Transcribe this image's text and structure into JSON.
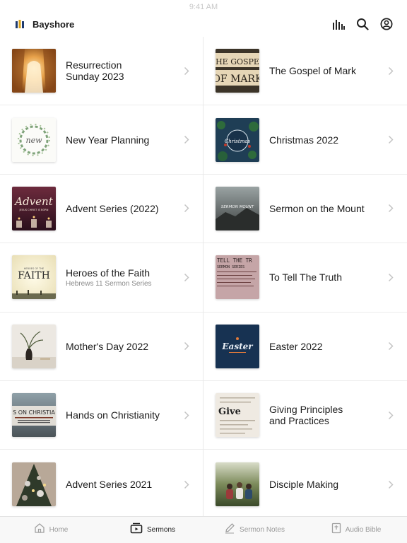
{
  "status": {
    "time": "9:41 AM"
  },
  "header": {
    "app_title": "Bayshore",
    "icons": [
      "logo-icon",
      "audio-bars-icon",
      "search-icon",
      "account-icon"
    ]
  },
  "sermons": {
    "left": [
      {
        "title": "Resurrection\nSunday 2023",
        "subtitle": "",
        "thumb": "tomb"
      },
      {
        "title": "New Year Planning",
        "subtitle": "",
        "thumb": "newyear",
        "thumb_text": "new"
      },
      {
        "title": "Advent Series (2022)",
        "subtitle": "",
        "thumb": "advent",
        "thumb_text": "Advent",
        "thumb_sub": "JESUS CHRIST IS BORN"
      },
      {
        "title": "Heroes of the Faith",
        "subtitle": "Hebrews 11 Sermon Series",
        "thumb": "faith",
        "thumb_text": "FAITH",
        "thumb_sub": "HEROES OF THE"
      },
      {
        "title": "Mother's Day 2022",
        "subtitle": "",
        "thumb": "vase"
      },
      {
        "title": "Hands on Christianity",
        "subtitle": "",
        "thumb": "hands",
        "thumb_text": "S ON CHRISTIA"
      },
      {
        "title": "Advent Series 2021",
        "subtitle": "",
        "thumb": "tree"
      }
    ],
    "right": [
      {
        "title": "The Gospel of Mark",
        "subtitle": "",
        "thumb": "mark",
        "thumb_text": "THE GOSPEL",
        "thumb_sub": "OF MARK"
      },
      {
        "title": "Christmas 2022",
        "subtitle": "",
        "thumb": "christmas",
        "thumb_text": "Christmas"
      },
      {
        "title": "Sermon on the Mount",
        "subtitle": "",
        "thumb": "mount",
        "thumb_text": "SERMON MOUNT"
      },
      {
        "title": "To Tell The Truth",
        "subtitle": "",
        "thumb": "truth",
        "thumb_text": "TELL THE TR",
        "thumb_sub": "SERMON SERIES"
      },
      {
        "title": "Easter 2022",
        "subtitle": "",
        "thumb": "easter",
        "thumb_text": "Easter"
      },
      {
        "title": "Giving Principles\nand Practices",
        "subtitle": "",
        "thumb": "give",
        "thumb_text": "Give"
      },
      {
        "title": "Disciple Making",
        "subtitle": "",
        "thumb": "disciple"
      }
    ]
  },
  "tabbar": {
    "tabs": [
      {
        "label": "Home",
        "icon": "home-icon",
        "active": false
      },
      {
        "label": "Sermons",
        "icon": "sermons-icon",
        "active": true
      },
      {
        "label": "Sermon Notes",
        "icon": "pencil-icon",
        "active": false
      },
      {
        "label": "Audio Bible",
        "icon": "bible-icon",
        "active": false
      }
    ]
  }
}
